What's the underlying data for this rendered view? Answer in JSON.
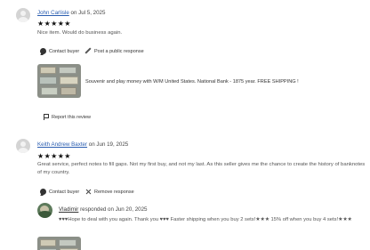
{
  "review1": {
    "author": "John Carlisle",
    "date_prefix": "on",
    "date": "Jul 5, 2025",
    "stars": "★★★★★",
    "text": "Nice item. Would do business again.",
    "contact_buyer": "Contact buyer",
    "post_response": "Post a public response",
    "listing_title": "Souvenir and play money with W/M United States. National Bank - 1875 year. FREE SHIPPING !",
    "report": "Report this review"
  },
  "review2": {
    "author": "Keith Andrew Baxter",
    "date_prefix": "on",
    "date": "Jun 19, 2025",
    "stars": "★★★★★",
    "text_line1": "Great service, perfect notes to fill gaps. Not my first buy, and not my last. As this seller gives me the chance to create the history of banknotes",
    "text_line2": "of my country.",
    "contact_buyer": "Contact buyer",
    "remove_response": "Remove response",
    "response": {
      "shop_name": "Vladimir",
      "responded_on": "responded on",
      "date": "Jun 20, 2025",
      "text": "♥♥♥Hope to deal with you again. Thank you ♥♥♥ Faster shipping when you buy 2 sets!★★★ 15% off when you buy 4 sets!★★★"
    }
  },
  "colors": {
    "author_link": "#2a5db0",
    "star": "#111111"
  }
}
